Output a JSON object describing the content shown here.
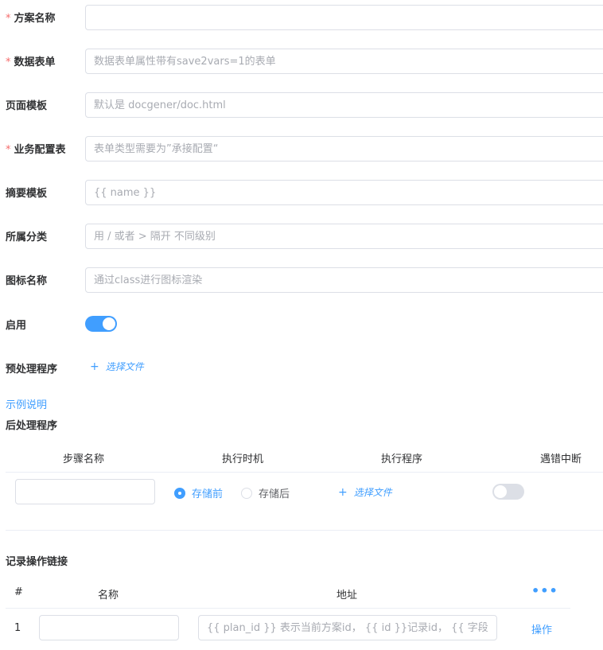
{
  "form": {
    "fields": [
      {
        "label": "方案名称",
        "required": true,
        "value": "",
        "placeholder": ""
      },
      {
        "label": "数据表单",
        "required": true,
        "value": "",
        "placeholder": "数据表单属性带有save2vars=1的表单"
      },
      {
        "label": "页面模板",
        "required": false,
        "value": "",
        "placeholder": "默认是 docgener/doc.html"
      },
      {
        "label": "业务配置表",
        "required": true,
        "value": "",
        "placeholder": "表单类型需要为”承接配置“"
      },
      {
        "label": "摘要模板",
        "required": false,
        "value": "",
        "placeholder": "{{ name }}"
      },
      {
        "label": "所属分类",
        "required": false,
        "value": "",
        "placeholder": "用 / 或者 > 隔开 不同级别"
      },
      {
        "label": "图标名称",
        "required": false,
        "value": "",
        "placeholder": "通过class进行图标渲染"
      }
    ],
    "required_mark": "*",
    "enable_label": "启用",
    "enable_on": true,
    "preprocess_label": "预处理程序",
    "select_file": "选择文件",
    "plus": "+",
    "example_link": "示例说明",
    "postprocess_label": "后处理程序"
  },
  "steps_table": {
    "headers": [
      "步骤名称",
      "执行时机",
      "执行程序",
      "遇错中断"
    ],
    "rows": [
      {
        "name": "",
        "timing_options": [
          "存储前",
          "存储后"
        ],
        "timing_selected": 0,
        "program": "选择文件",
        "abort_on_error": false
      }
    ]
  },
  "links_section": {
    "title": "记录操作链接",
    "headers": [
      "#",
      "名称",
      "地址"
    ],
    "more_icon": "•••",
    "rows": [
      {
        "index": "1",
        "name": "",
        "address_placeholder": "{{ plan_id }} 表示当前方案id， {{ id }}记录id， {{ 字段名 }}",
        "action": "操作"
      }
    ]
  },
  "colors": {
    "primary": "#409eff",
    "required": "#f56c6c",
    "border": "#dcdfe6"
  }
}
